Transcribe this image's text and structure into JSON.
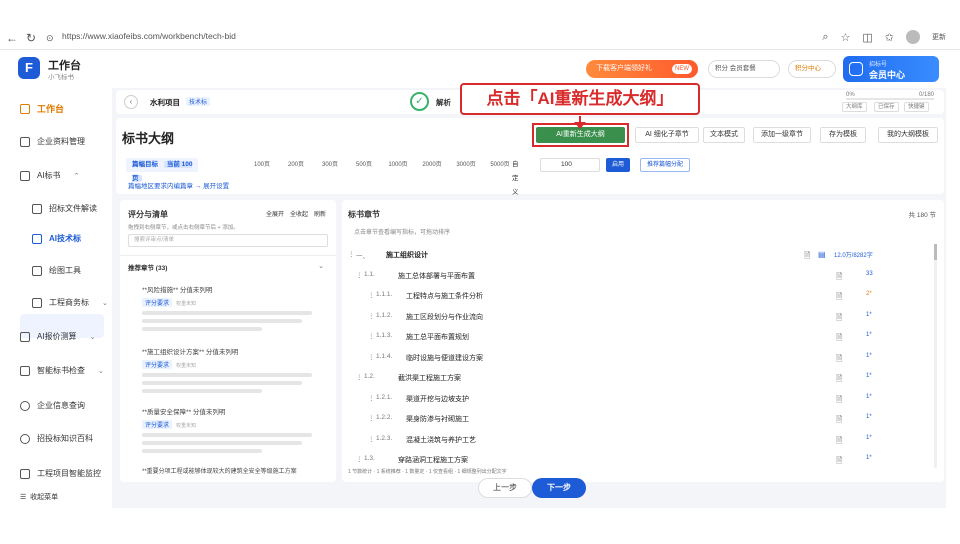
{
  "browser": {
    "url": "https://www.xiaofeibs.com/workbench/tech-bid",
    "update_label": "更新"
  },
  "header": {
    "app_title": "工作台",
    "app_subtitle": "小飞标书",
    "promo_label": "下载客户端领好礼",
    "promo_tag": "NEW",
    "points_label": "积分  会员套餐",
    "points_center": "积分中心",
    "member_small": "招标号",
    "member_label": "会员中心"
  },
  "sidebar": {
    "items": [
      {
        "label": "工作台"
      },
      {
        "label": "企业资料管理"
      },
      {
        "label": "AI标书"
      },
      {
        "label": "招标文件解读"
      },
      {
        "label": "AI技术标"
      },
      {
        "label": "绘图工具"
      },
      {
        "label": "工程商务标"
      },
      {
        "label": "AI报价测算"
      },
      {
        "label": "智能标书检查"
      },
      {
        "label": "企业信息查询"
      },
      {
        "label": "招投标知识百科"
      },
      {
        "label": "工程项目智能监控"
      }
    ],
    "collapse_label": "收起菜单"
  },
  "topbar": {
    "project_name": "水利项目",
    "project_tag": "技术标",
    "step_label": "解析",
    "progress_label": "0%",
    "progress_value": "0/180",
    "progress_fraction": 0,
    "btn_1": "大纲库",
    "btn_2": "已保存",
    "btn_3": "快捷键"
  },
  "annotation": {
    "text": "点击「AI重新生成大纲」",
    "color": "#d92b2b"
  },
  "outline": {
    "title": "标书大纲",
    "actions": [
      "AI重新生成大纲",
      "AI 细化子章节",
      "文本模式",
      "添加一级章节",
      "存为模板",
      "我的大纲模板"
    ],
    "target_label": "篇幅目标",
    "current_label": "当前 100 页",
    "page_options": [
      "100页",
      "200页",
      "300页",
      "500页",
      "1000页",
      "2000页",
      "3000页",
      "5000页"
    ],
    "custom_label": "自定义",
    "custom_value": "100",
    "apply_label": "启用",
    "recommend_label": "推荐篇幅分配",
    "link_text": "篇幅地区要求内编篇章 → 展开设置"
  },
  "left_panel": {
    "title": "评分与清单",
    "actions": [
      "全展开",
      "全收起",
      "刷新"
    ],
    "hint": "拖拽到右侧章节，或点击右侧章节后 + 添加。",
    "search_placeholder": "搜索评审点/清单",
    "section_title": "推荐章节 (33)",
    "requirements": [
      {
        "title": "**风险措施** 分值未列明",
        "tag": "评分要求",
        "meta": "权重未知"
      },
      {
        "title": "**施工组织设计方案** 分值未列明",
        "tag": "评分要求",
        "meta": "权重未知"
      },
      {
        "title": "**质量安全保障** 分值未列明",
        "tag": "评分要求",
        "meta": "权重未知"
      }
    ],
    "footer": "**重要分项工程或能够体现较大的建筑全安全等级施工方案"
  },
  "right_panel": {
    "title": "标书章节",
    "count": "共 180 节",
    "hint": "点击章节查看编写指标，可拖动排序",
    "rows": [
      {
        "num": "一、",
        "title": "施工组织设计",
        "words": "12.0万/8282字",
        "level": 0
      },
      {
        "num": "1.1.",
        "title": "施工总体部署与平面布置",
        "words": "33",
        "level": 1
      },
      {
        "num": "1.1.1.",
        "title": "工程特点与施工条件分析",
        "words": "2*",
        "level": 2
      },
      {
        "num": "1.1.2.",
        "title": "施工区段划分与作业流向",
        "words": "1*",
        "level": 2
      },
      {
        "num": "1.1.3.",
        "title": "施工总平面布置规划",
        "words": "1*",
        "level": 2
      },
      {
        "num": "1.1.4.",
        "title": "临时设施与便道建设方案",
        "words": "1*",
        "level": 2
      },
      {
        "num": "1.2.",
        "title": "截洪渠工程施工方案",
        "words": "1*",
        "level": 1
      },
      {
        "num": "1.2.1.",
        "title": "渠道开挖与边坡支护",
        "words": "1*",
        "level": 2
      },
      {
        "num": "1.2.2.",
        "title": "渠身防渗与衬砌施工",
        "words": "1*",
        "level": 2
      },
      {
        "num": "1.2.3.",
        "title": "混凝土浇筑与养护工艺",
        "words": "1*",
        "level": 2
      },
      {
        "num": "1.3.",
        "title": "穿路涵洞工程施工方案",
        "words": "1*",
        "level": 1
      }
    ],
    "footer": "1 节数统计 · 1 系统推荐 · 1 数量定 · 1 仅查看组 · 1 细规整列出分配文字"
  },
  "footer": {
    "prev_label": "上一步",
    "next_label": "下一步"
  }
}
